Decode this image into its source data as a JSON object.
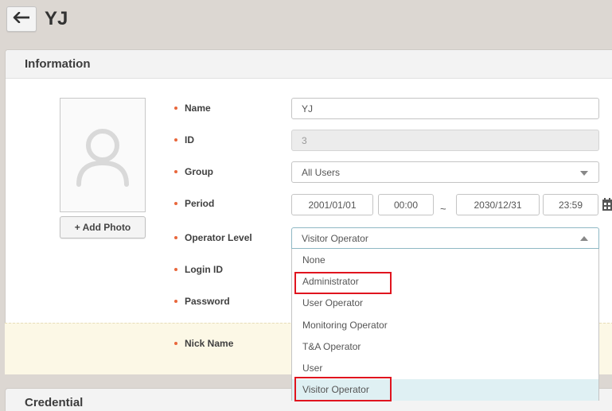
{
  "header": {
    "title": "YJ"
  },
  "sections": {
    "information": "Information",
    "credential": "Credential"
  },
  "photo": {
    "add_label": "+ Add Photo"
  },
  "fields": {
    "name": {
      "label": "Name",
      "value": "YJ"
    },
    "id": {
      "label": "ID",
      "value": "3"
    },
    "group": {
      "label": "Group",
      "value": "All Users"
    },
    "period": {
      "label": "Period",
      "start_date": "2001/01/01",
      "start_time": "00:00",
      "separator": "~",
      "end_date": "2030/12/31",
      "end_time": "23:59"
    },
    "operator_level": {
      "label": "Operator Level",
      "value": "Visitor Operator"
    },
    "login_id": {
      "label": "Login ID"
    },
    "password": {
      "label": "Password"
    },
    "nick_name": {
      "label": "Nick Name"
    }
  },
  "operator_level_options": [
    "None",
    "Administrator",
    "User Operator",
    "Monitoring Operator",
    "T&A Operator",
    "User",
    "Visitor Operator"
  ],
  "icons": {
    "back": "arrow-left-icon",
    "avatar": "user-silhouette-icon",
    "calendar": "calendar-icon",
    "dropdown": "chevron-down-icon"
  },
  "colors": {
    "required_bullet": "#e8673c",
    "highlight_box": "#e0141e",
    "selected_option_bg": "#dff0f3",
    "nick_band_bg": "#fcf8e6"
  }
}
